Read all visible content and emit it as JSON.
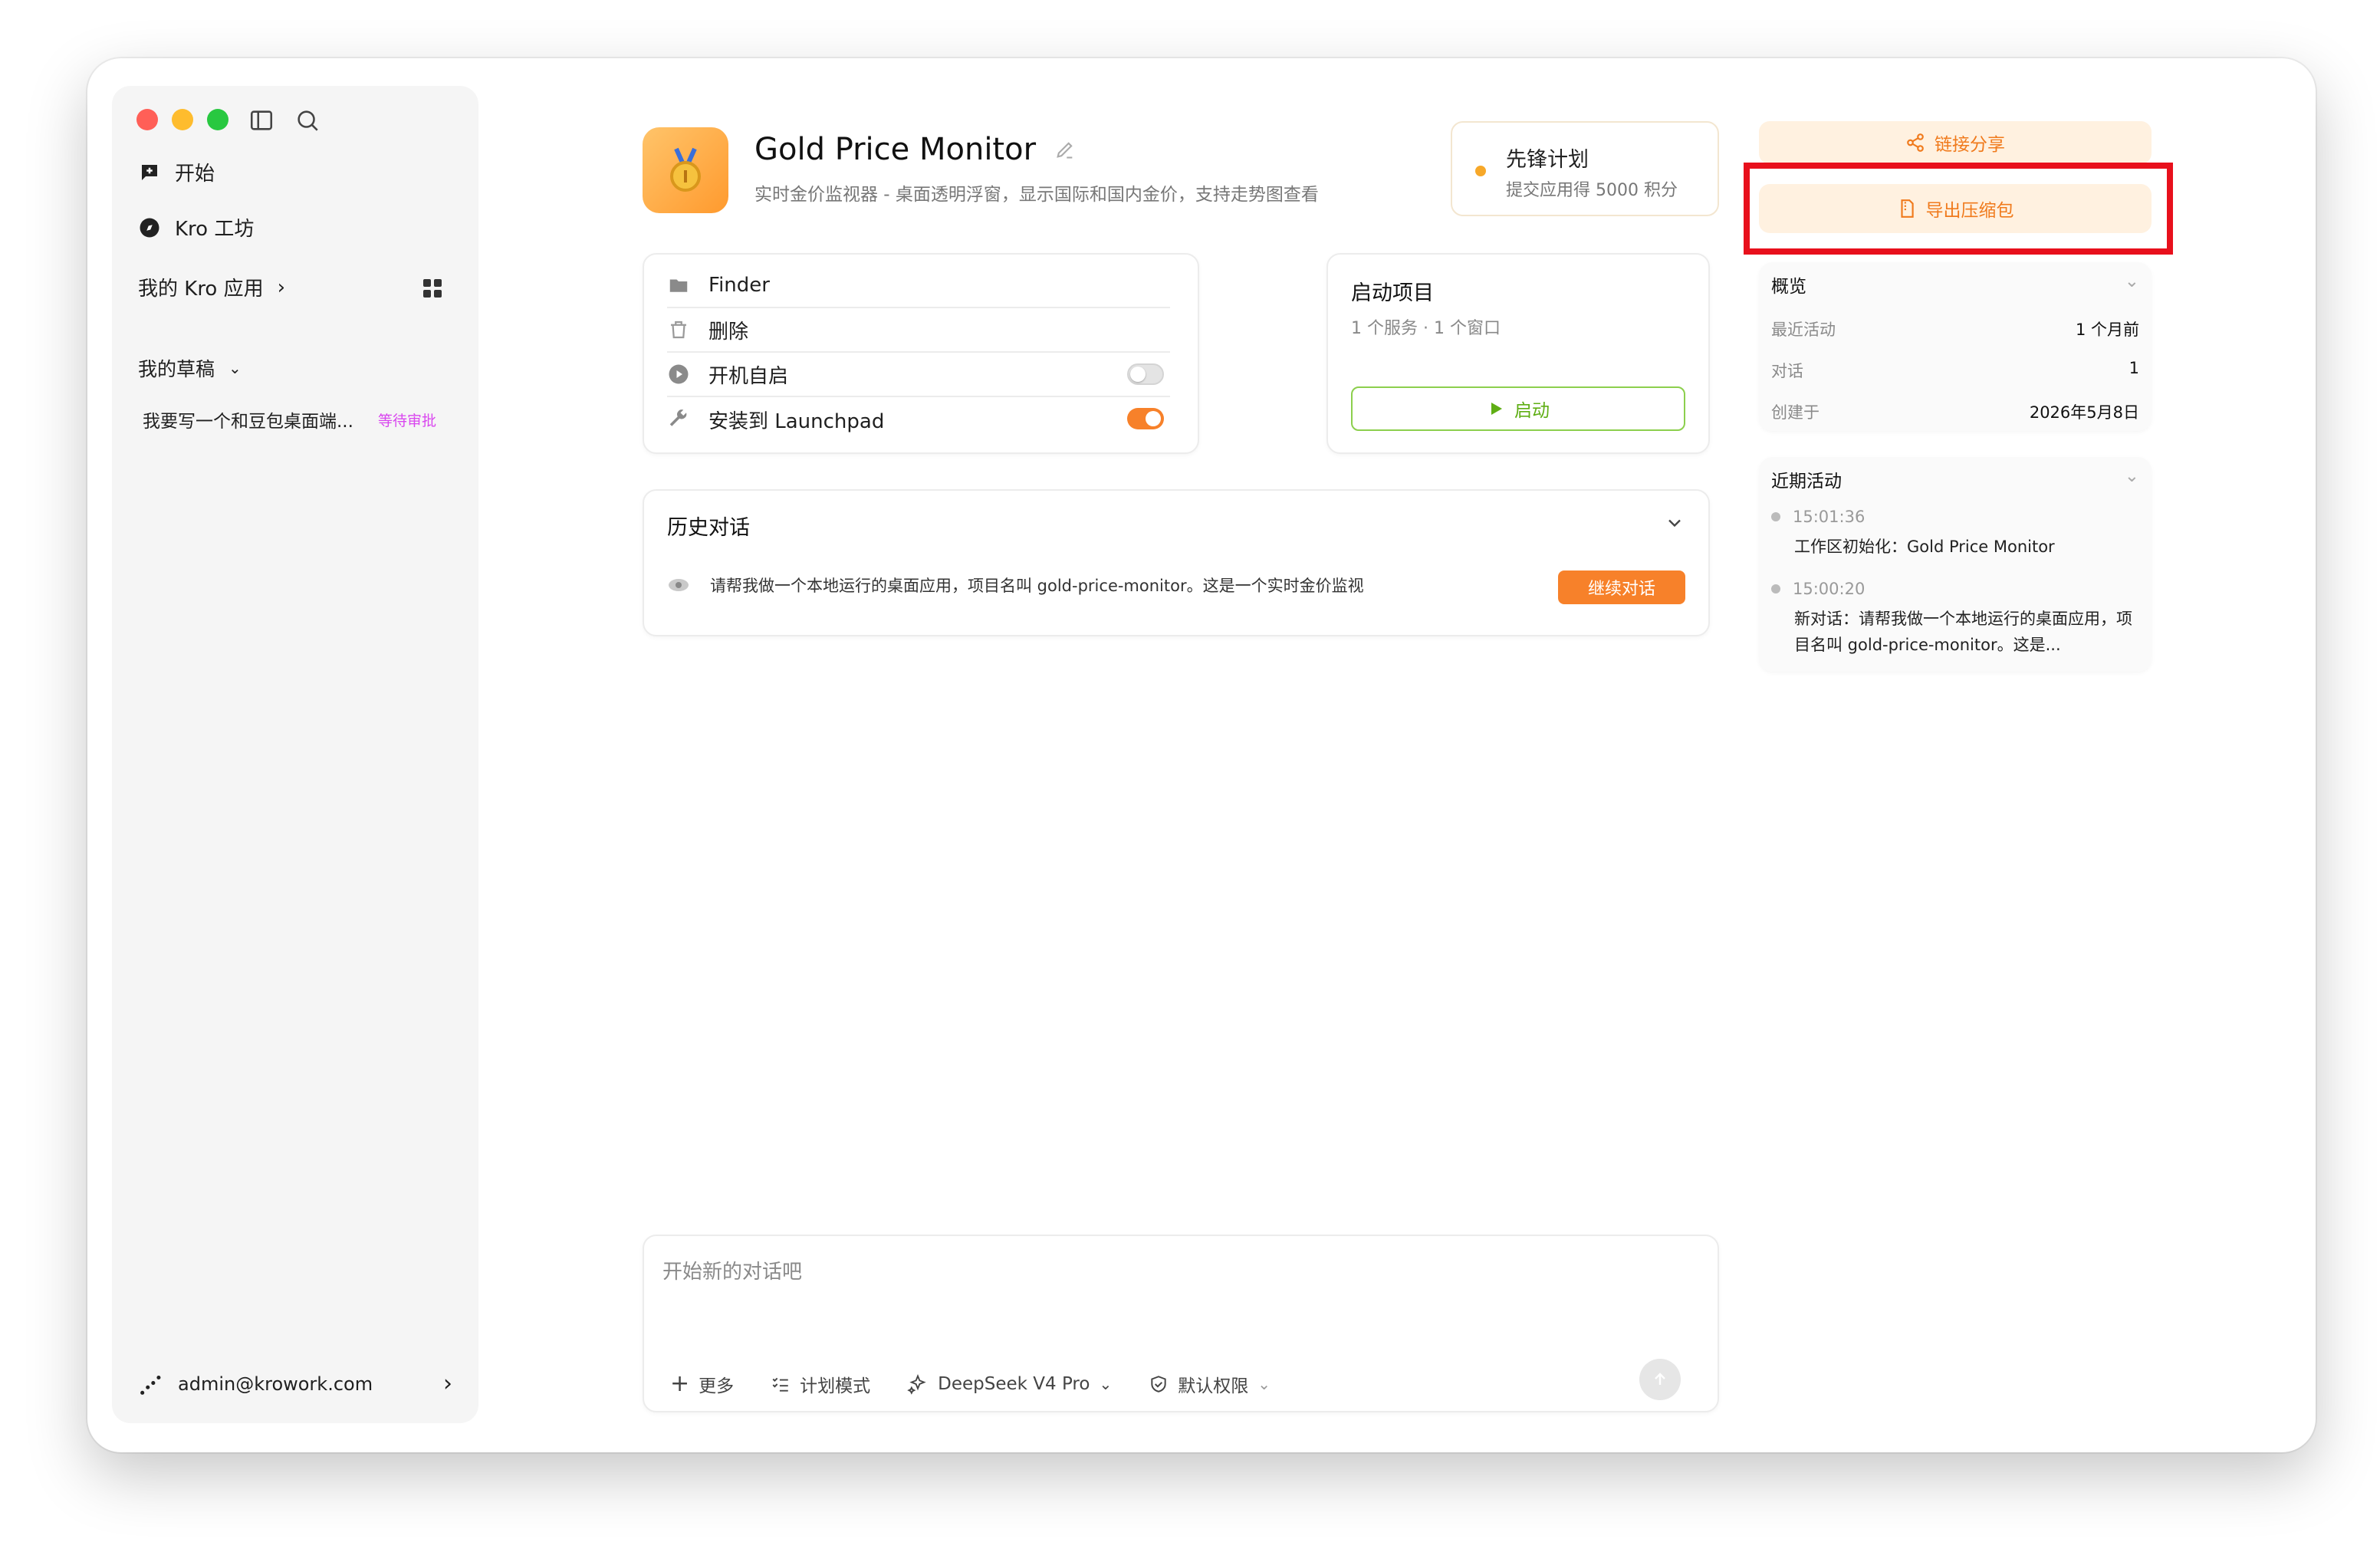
{
  "sidebar": {
    "nav": [
      {
        "label": "开始",
        "icon": "chat-plus-icon"
      },
      {
        "label": "Kro 工坊",
        "icon": "compass-icon"
      }
    ],
    "my_apps_label": "我的 Kro 应用",
    "drafts_label": "我的草稿",
    "draft_item": {
      "title": "我要写一个和豆包桌面端...",
      "status": "等待审批"
    },
    "account_email": "admin@krowork.com"
  },
  "app": {
    "title": "Gold Price Monitor",
    "subtitle": "实时金价监视器 - 桌面透明浮窗，显示国际和国内金价，支持走势图查看"
  },
  "pioneer": {
    "title": "先锋计划",
    "subtitle": "提交应用得 5000 积分"
  },
  "share_label": "链接分享",
  "export_label": "导出压缩包",
  "actions": [
    {
      "label": "Finder",
      "icon": "folder-icon"
    },
    {
      "label": "删除",
      "icon": "trash-icon"
    },
    {
      "label": "开机自启",
      "icon": "play-circle-icon",
      "toggle": "off"
    },
    {
      "label": "安装到 Launchpad",
      "icon": "wrench-icon",
      "toggle": "on"
    }
  ],
  "launch": {
    "title": "启动项目",
    "subtitle": "1 个服务 · 1 个窗口",
    "start_label": "启动"
  },
  "history": {
    "title": "历史对话",
    "item": "请帮我做一个本地运行的桌面应用，项目名叫 gold-price-monitor。这是一个实时金价监视",
    "continue_label": "继续对话"
  },
  "overview": {
    "title": "概览",
    "rows": [
      {
        "k": "最近活动",
        "v": "1 个月前"
      },
      {
        "k": "对话",
        "v": "1"
      },
      {
        "k": "创建于",
        "v": "2026年5月8日"
      }
    ]
  },
  "recent": {
    "title": "近期活动",
    "items": [
      {
        "time": "15:01:36",
        "desc": "工作区初始化：Gold Price Monitor"
      },
      {
        "time": "15:00:20",
        "desc": "新对话：请帮我做一个本地运行的桌面应用，项目名叫 gold-price-monitor。这是..."
      }
    ]
  },
  "composer": {
    "placeholder": "开始新的对话吧",
    "more": "更多",
    "plan": "计划模式",
    "model": "DeepSeek V4 Pro",
    "perm": "默认权限"
  },
  "colors": {
    "accent": "#f7812a",
    "green": "#5fae14",
    "highlight": "#e8101c"
  }
}
